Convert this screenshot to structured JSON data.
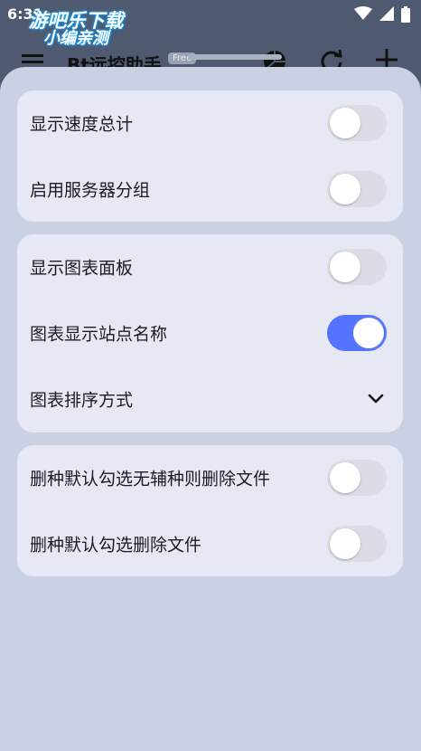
{
  "status_bar": {
    "time": "6:31"
  },
  "watermark": {
    "line1": "游吧乐下载",
    "line2": "小编亲测"
  },
  "app_bar": {
    "title": "Bt远控助手",
    "badge": "Free"
  },
  "settings": {
    "groups": [
      {
        "items": [
          {
            "label": "显示速度总计",
            "type": "toggle",
            "on": false
          },
          {
            "label": "启用服务器分组",
            "type": "toggle",
            "on": false
          }
        ]
      },
      {
        "items": [
          {
            "label": "显示图表面板",
            "type": "toggle",
            "on": false
          },
          {
            "label": "图表显示站点名称",
            "type": "toggle",
            "on": true
          },
          {
            "label": "图表排序方式",
            "type": "dropdown"
          }
        ]
      },
      {
        "items": [
          {
            "label": "删种默认勾选无辅种则删除文件",
            "type": "toggle",
            "on": false
          },
          {
            "label": "删种默认勾选删除文件",
            "type": "toggle",
            "on": false
          }
        ]
      }
    ]
  },
  "colors": {
    "accent": "#5474ff",
    "sheet_bg": "#c9d1e3",
    "card_bg": "#e6e9f4",
    "toggle_off": "#dadde5"
  }
}
